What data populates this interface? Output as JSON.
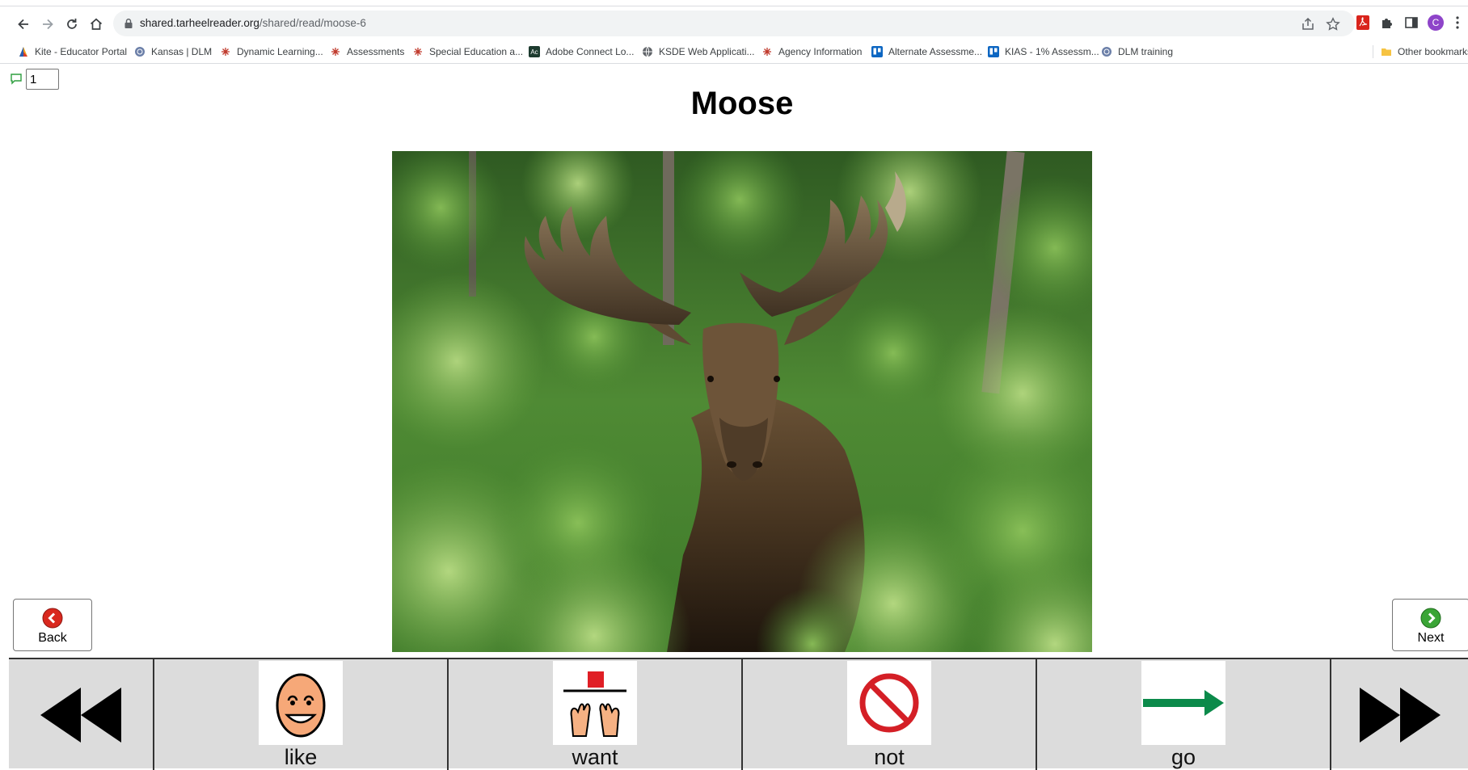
{
  "browser": {
    "url_host": "shared.tarheelreader.org",
    "url_path": "/shared/read/moose-6",
    "profile_initial": "C",
    "bookmarks": [
      {
        "label": "Kite - Educator Portal",
        "icon": "kite-icon"
      },
      {
        "label": "Kansas | DLM",
        "icon": "globe-icon"
      },
      {
        "label": "Dynamic Learning...",
        "icon": "star-burst-icon"
      },
      {
        "label": "Assessments",
        "icon": "star-burst-icon"
      },
      {
        "label": "Special Education a...",
        "icon": "star-burst-icon"
      },
      {
        "label": "Adobe Connect Lo...",
        "icon": "adobe-connect-icon"
      },
      {
        "label": "KSDE Web Applicati...",
        "icon": "globe-icon"
      },
      {
        "label": "Agency Information",
        "icon": "star-burst-icon"
      },
      {
        "label": "Alternate Assessme...",
        "icon": "trello-icon"
      },
      {
        "label": "KIAS - 1% Assessm...",
        "icon": "trello-icon"
      },
      {
        "label": "DLM training",
        "icon": "globe-icon"
      }
    ],
    "other_bookmarks": "Other bookmarks"
  },
  "reader": {
    "page_number": "1",
    "title": "Moose",
    "image_subject": "moose-photo",
    "back_label": "Back",
    "next_label": "Next"
  },
  "choices": [
    {
      "word": "like",
      "icon": "smiling-face-icon"
    },
    {
      "word": "want",
      "icon": "want-hands-icon"
    },
    {
      "word": "not",
      "icon": "no-sign-icon"
    },
    {
      "word": "go",
      "icon": "right-arrow-icon"
    }
  ],
  "colors": {
    "back_button": "#d9281e",
    "next_button": "#3aa536",
    "go_arrow": "#0b8a4a",
    "not_sign": "#d41f26"
  }
}
